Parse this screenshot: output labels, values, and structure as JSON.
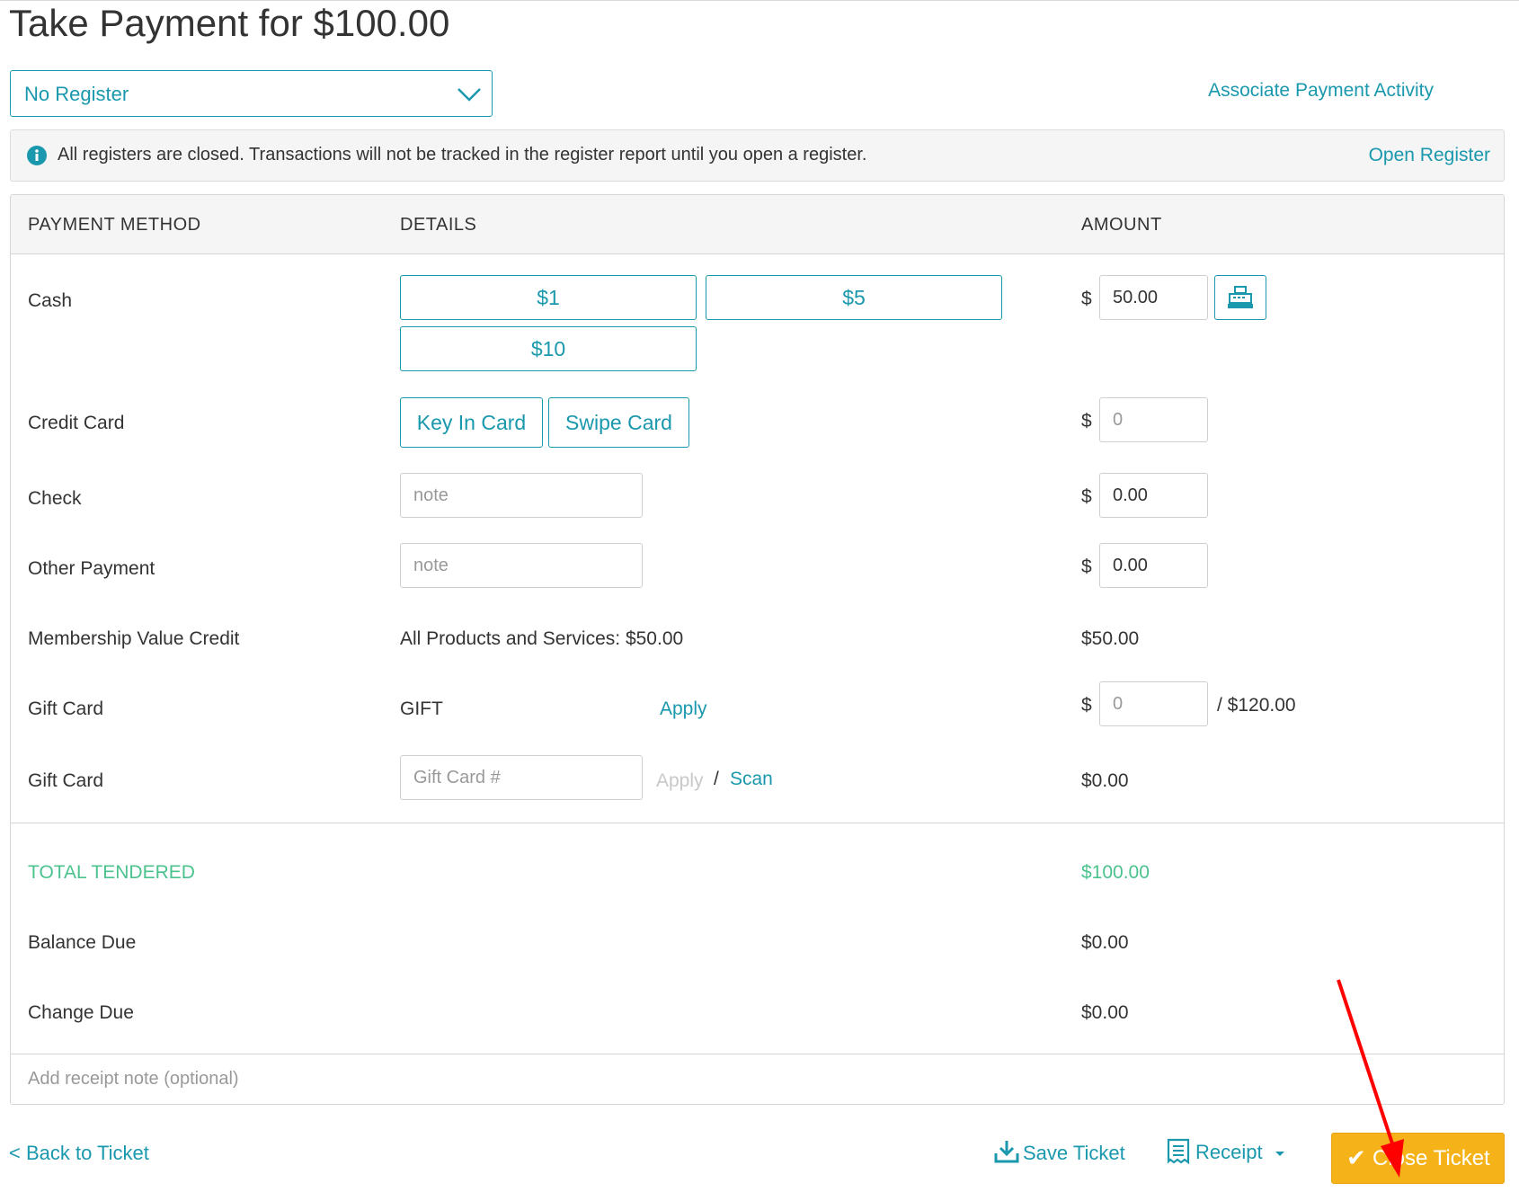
{
  "page": {
    "title": "Take Payment for $100.00"
  },
  "register": {
    "selected": "No Register",
    "associate_link": "Associate Payment Activity"
  },
  "notice": {
    "message": "All registers are closed. Transactions will not be tracked in the register report until you open a register.",
    "open_register_link": "Open Register"
  },
  "table": {
    "headers": {
      "method": "PAYMENT METHOD",
      "details": "DETAILS",
      "amount": "AMOUNT"
    },
    "currency_symbol": "$",
    "cash": {
      "label": "Cash",
      "quick_amounts": [
        "$1",
        "$5",
        "$10"
      ],
      "amount": "50.00",
      "drawer_icon": "cash-register-icon"
    },
    "credit_card": {
      "label": "Credit Card",
      "key_in": "Key In Card",
      "swipe": "Swipe Card",
      "amount_placeholder": "0"
    },
    "check": {
      "label": "Check",
      "note_placeholder": "note",
      "amount": "0.00"
    },
    "other_payment": {
      "label": "Other Payment",
      "note_placeholder": "note",
      "amount": "0.00"
    },
    "membership": {
      "label": "Membership Value Credit",
      "details": "All Products and Services: $50.00",
      "amount": "$50.00"
    },
    "gift_card_1": {
      "label": "Gift Card",
      "code": "GIFT",
      "apply": "Apply",
      "amount_placeholder": "0",
      "balance": "/ $120.00"
    },
    "gift_card_2": {
      "label": "Gift Card",
      "number_placeholder": "Gift Card #",
      "apply": "Apply",
      "separator": "/",
      "scan": "Scan",
      "amount": "$0.00"
    },
    "totals": {
      "tendered_label": "TOTAL TENDERED",
      "tendered_value": "$100.00",
      "balance_label": "Balance Due",
      "balance_value": "$0.00",
      "change_label": "Change Due",
      "change_value": "$0.00"
    },
    "receipt_note_placeholder": "Add receipt note (optional)"
  },
  "footer": {
    "back": "< Back to Ticket",
    "save": "Save Ticket",
    "receipt": "Receipt",
    "close": "Close Ticket"
  },
  "colors": {
    "accent": "#1a98ad",
    "success": "#4cc28e",
    "close_button": "#f6b319",
    "annotation_arrow": "#ff0000"
  }
}
